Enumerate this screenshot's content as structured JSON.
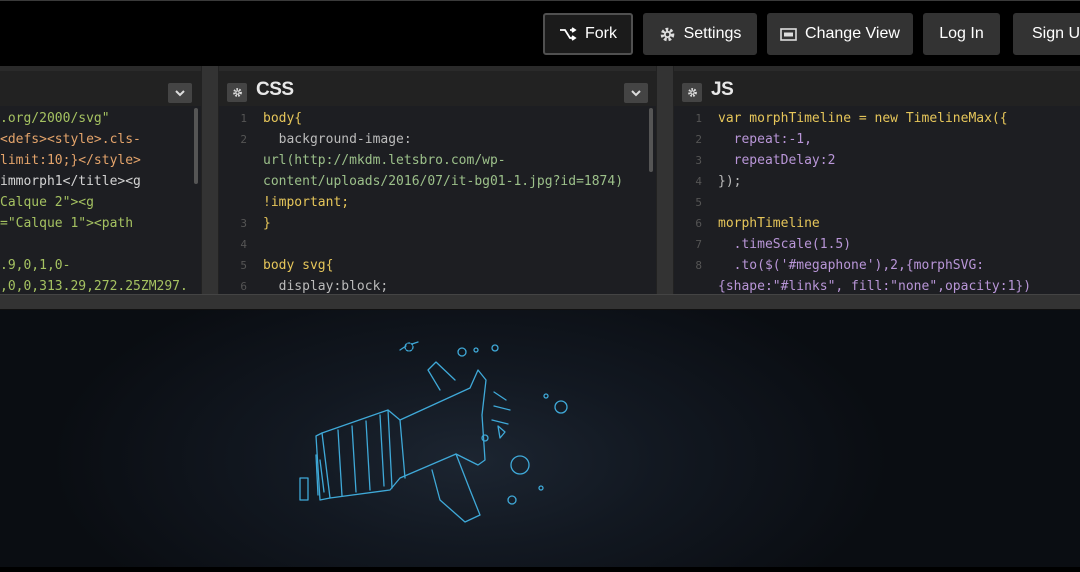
{
  "topbar": {
    "fork_label": "Fork",
    "settings_label": "Settings",
    "change_view_label": "Change View",
    "login_label": "Log In",
    "signup_label": "Sign Up"
  },
  "panes": {
    "html": {
      "title": "",
      "lines": [
        ".org/2000/svg\"",
        "<defs><style>.cls-",
        "limit:10;}</style>",
        "immorph1</title><g",
        "Calque 2\"><g",
        "=\"Calque 1\"><path",
        "",
        ".9,0,1,0-",
        ",0,0,313.29,272.25ZM297."
      ]
    },
    "css": {
      "title": "CSS",
      "line_numbers": [
        "1",
        "2",
        "",
        "",
        "3",
        "4",
        "5",
        "6"
      ],
      "lines": [
        "body{",
        "  background-image:",
        "url(http://mkdm.letsbro.com/wp-",
        "content/uploads/2016/07/it-bg01-1.jpg?id=1874)",
        "!important;",
        "}",
        "",
        "body svg{",
        "  display:block;"
      ]
    },
    "js": {
      "title": "JS",
      "line_numbers": [
        "1",
        "2",
        "3",
        "4",
        "5",
        "6",
        "7",
        "8",
        ""
      ],
      "lines": [
        "var morphTimeline = new TimelineMax({",
        "  repeat:-1,",
        "  repeatDelay:2",
        "});",
        "",
        "morphTimeline",
        "  .timeScale(1.5)",
        "  .to($('#megaphone'),2,{morphSVG:",
        "{shape:\"#links\", fill:\"none\",opacity:1})"
      ]
    }
  },
  "icons": {
    "fork": "fork-icon",
    "settings": "gear-icon",
    "change_view": "layout-icon",
    "collapse": "chevron-down-icon",
    "preview": "megaphone-illustration"
  },
  "colors": {
    "accent_line": "#3fa9d8",
    "button_bg": "#333333",
    "editor_bg": "#1d1e22"
  }
}
